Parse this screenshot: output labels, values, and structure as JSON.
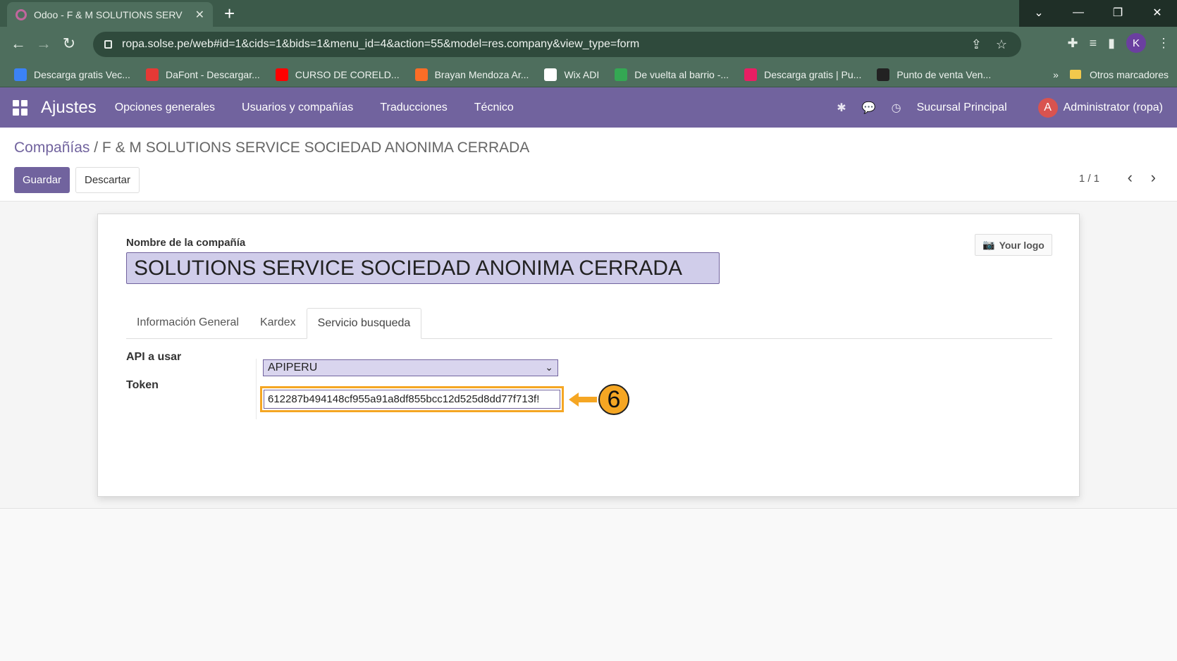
{
  "browser": {
    "tab_title": "Odoo - F & M SOLUTIONS SERV",
    "url": "ropa.solse.pe/web#id=1&cids=1&bids=1&menu_id=4&action=55&model=res.company&view_type=form",
    "profile_initial": "K",
    "bookmarks": [
      {
        "label": "Descarga gratis Vec...",
        "color": "#3b82f6"
      },
      {
        "label": "DaFont - Descargar...",
        "color": "#e53935"
      },
      {
        "label": "CURSO DE CORELD...",
        "color": "#ff0000"
      },
      {
        "label": "Brayan Mendoza Ar...",
        "color": "#fc6d26"
      },
      {
        "label": "Wix ADI",
        "color": "#ffffff"
      },
      {
        "label": "De vuelta al barrio -...",
        "color": "#34a853"
      },
      {
        "label": "Descarga gratis | Pu...",
        "color": "#e91e63"
      },
      {
        "label": "Punto de venta Ven...",
        "color": "#222222"
      }
    ],
    "more_bookmarks": "»",
    "other_bookmarks": "Otros marcadores"
  },
  "odoo_nav": {
    "app": "Ajustes",
    "menu": [
      "Opciones generales",
      "Usuarios y compañías",
      "Traducciones",
      "Técnico"
    ],
    "branch": "Sucursal Principal",
    "user_initial": "A",
    "user": "Administrator (ropa)"
  },
  "control": {
    "breadcrumb_parent": "Compañías",
    "breadcrumb_sep": " / ",
    "breadcrumb_current": "F & M SOLUTIONS SERVICE SOCIEDAD ANONIMA CERRADA",
    "save": "Guardar",
    "discard": "Descartar",
    "pager": "1 / 1"
  },
  "form": {
    "company_label": "Nombre de la compañía",
    "company_value": "SOLUTIONS SERVICE SOCIEDAD ANONIMA CERRADA",
    "logo_button": "Your logo",
    "tabs": [
      "Información General",
      "Kardex",
      "Servicio busqueda"
    ],
    "active_tab": "Servicio busqueda",
    "api_label": "API a usar",
    "api_value": "APIPERU",
    "token_label": "Token",
    "token_value": "612287b494148cf955a91a8df855bcc12d525d8dd77f713f!"
  },
  "annotation": {
    "step": "6",
    "color": "#f5a623"
  }
}
